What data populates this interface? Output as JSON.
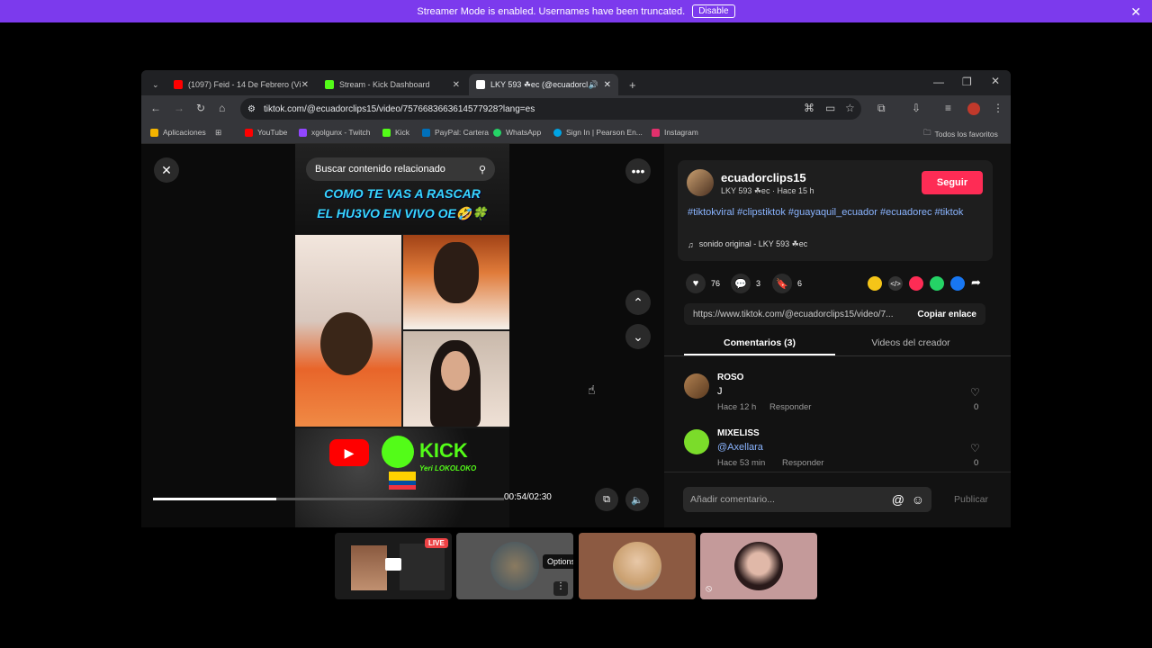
{
  "banner": {
    "text": "Streamer Mode is enabled. Usernames have been truncated.",
    "disable_label": "Disable"
  },
  "browser": {
    "tabs": [
      {
        "label": "(1097) Feid - 14 De Febrero (Vi",
        "color": "#ff0000"
      },
      {
        "label": "Stream - Kick Dashboard",
        "color": "#53fc18"
      },
      {
        "label": "LKY 593 ☘ec (@ecuadorcl",
        "color": "#ffffff"
      }
    ],
    "url": "tiktok.com/@ecuadorclips15/video/7576683663614577928?lang=es",
    "bookmarks": [
      {
        "label": "Aplicaciones",
        "color": "#f4b400"
      },
      {
        "label": "YouTube",
        "color": "#ff0000"
      },
      {
        "label": "xgolgunx - Twitch",
        "color": "#9146ff"
      },
      {
        "label": "Kick",
        "color": "#53fc18"
      },
      {
        "label": "PayPal: Cartera",
        "color": "#0070ba"
      },
      {
        "label": "WhatsApp",
        "color": "#25d366"
      },
      {
        "label": "Sign In | Pearson En...",
        "color": "#00a4e4"
      },
      {
        "label": "Instagram",
        "color": "#e1306c"
      }
    ],
    "all_bookmarks": "Todos los favoritos"
  },
  "video": {
    "search_placeholder": "Buscar contenido relacionado",
    "caption_line1": "COMO TE VAS A RASCAR",
    "caption_line2": "EL HU3VO EN VIVO OE🤣🍀",
    "kick_label": "KICK",
    "kick_sub": "Yeri LOKOLOKO",
    "time": "00:54/02:30",
    "progress": 0.35
  },
  "post": {
    "username": "ecuadorclips15",
    "display": "LKY 593 ☘ec · Hace 15 h",
    "follow": "Seguir",
    "hashtags": "#tiktokviral #clipstiktok #guayaquil_ecuador #ecuadorec #tiktok",
    "sound": "sonido original - LKY 593 ☘ec",
    "likes": "76",
    "comments_count": "3",
    "saves": "6",
    "link": "https://www.tiktok.com/@ecuadorclips15/video/7...",
    "copy_link": "Copiar enlace",
    "tab_comments": "Comentarios (3)",
    "tab_creator": "Videos del creador",
    "comments": [
      {
        "user": "ROSO",
        "text": "J",
        "time": "Hace 12 h",
        "reply": "Responder",
        "likes": "0"
      },
      {
        "user": "MIXELISS",
        "text": "@Axellara",
        "time": "Hace 53 min",
        "reply": "Responder",
        "likes": "0"
      }
    ],
    "add_comment": "Añadir comentario...",
    "publish": "Publicar"
  },
  "call": {
    "live_badge": "LIVE",
    "tooltip": "Options"
  }
}
